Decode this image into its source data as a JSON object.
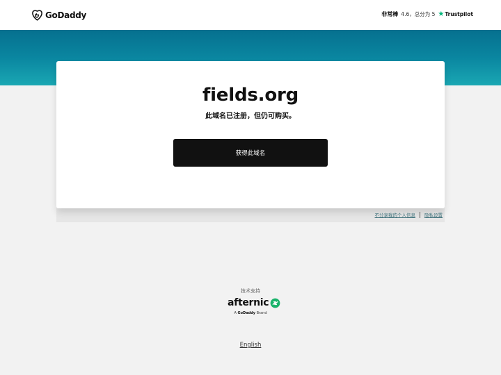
{
  "header": {
    "logo_text": "GoDaddy",
    "rating_label": "非常棒",
    "rating_score": "4.6，总分为 5",
    "trustpilot_text": "Trustpilot"
  },
  "card": {
    "domain": "fields.org",
    "subtitle": "此域名已注册，但仍可购买。",
    "buy_button_label": "获得此域名"
  },
  "privacy": {
    "do_not_share_label": "不分享我的个人信息",
    "privacy_settings_label": "隐私设置"
  },
  "footer": {
    "powered_by": "技术支持",
    "brand_name": "afternic",
    "brand_sub_prefix": "A",
    "brand_sub_name": "GoDaddy",
    "brand_sub_suffix": "Brand",
    "language_link": "English"
  },
  "colors": {
    "banner_top": "#06708f",
    "banner_bottom": "#1aa7b3",
    "button_bg": "#111111",
    "trustpilot_green": "#00b67a",
    "afternic_green": "#1ab36b",
    "link_color": "#3a6e78"
  },
  "icons": {
    "logo": "godaddy-logo-icon",
    "trustpilot": "star-icon",
    "afternic": "afternic-arrows-icon"
  }
}
